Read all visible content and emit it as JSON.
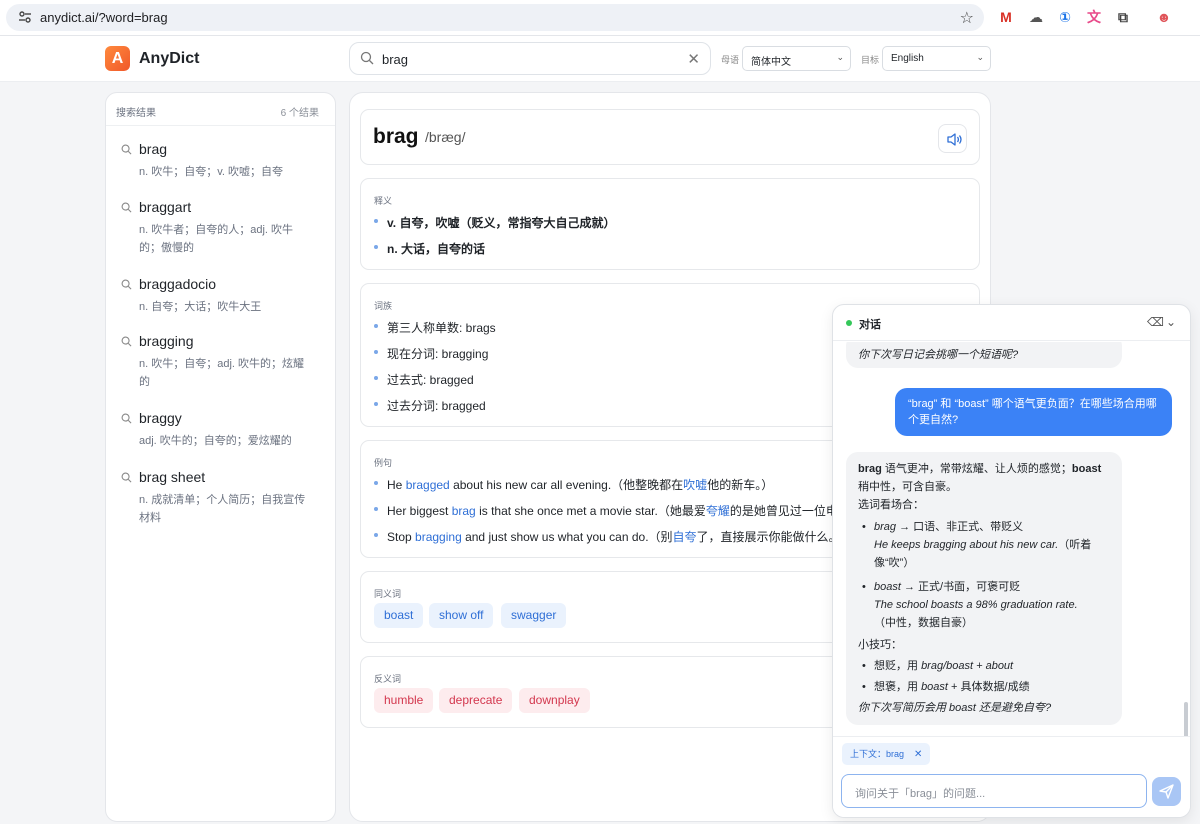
{
  "browser": {
    "url": "anydict.ai/?word=brag",
    "extensions": [
      {
        "name": "gmail-icon",
        "glyph": "M",
        "color": "#d93025"
      },
      {
        "name": "cloud-icon",
        "glyph": "☁",
        "color": "#555555"
      },
      {
        "name": "password-icon",
        "glyph": "①",
        "color": "#1a73e8"
      },
      {
        "name": "translate-icon",
        "glyph": "文",
        "color": "#e84a8a"
      },
      {
        "name": "puzzle-icon",
        "glyph": "⧉",
        "color": "#444444"
      },
      {
        "name": "profile-icon",
        "glyph": "☻",
        "color": "#e0555a"
      }
    ]
  },
  "header": {
    "logo_letter": "A",
    "brand": "AnyDict",
    "search_value": "brag",
    "native_label": "母语",
    "native_value": "简体中文",
    "target_label": "目标",
    "target_value": "English"
  },
  "results": {
    "title": "搜索结果",
    "count": "6 个结果",
    "items": [
      {
        "word": "brag",
        "gloss": "n. 吹牛；自夸；v. 吹嘘；自夸"
      },
      {
        "word": "braggart",
        "gloss": "n. 吹牛者；自夸的人；adj. 吹牛的；傲慢的"
      },
      {
        "word": "braggadocio",
        "gloss": "n. 自夸；大话；吹牛大王"
      },
      {
        "word": "bragging",
        "gloss": "n. 吹牛；自夸；adj. 吹牛的；炫耀的"
      },
      {
        "word": "braggy",
        "gloss": "adj. 吹牛的；自夸的；爱炫耀的"
      },
      {
        "word": "brag sheet",
        "gloss": "n. 成就清单；个人简历；自我宣传材料"
      }
    ]
  },
  "entry": {
    "headword": "brag",
    "phonetic": "/bræg/",
    "definitions_title": "释义",
    "definitions": [
      "v. 自夸，吹嘘（贬义，常指夸大自己成就）",
      "n. 大话，自夸的话"
    ],
    "forms_title": "词族",
    "forms": [
      "第三人称单数: brags",
      "现在分词: bragging",
      "过去式: bragged",
      "过去分词: bragged"
    ],
    "examples_title": "例句",
    "examples": [
      {
        "a": "He ",
        "hl1": "bragged",
        "b": " about his new car all evening.（他整晚都在",
        "hl2": "吹嘘",
        "c": "他的新车。）"
      },
      {
        "a": "Her biggest ",
        "hl1": "brag",
        "b": " is that she once met a movie star.（她最爱",
        "hl2": "夸耀",
        "c": "的是她曾见过一位电影明星。）"
      },
      {
        "a": "Stop ",
        "hl1": "bragging",
        "b": " and just show us what you can do.（别",
        "hl2": "自夸",
        "c": "了，直接展示你能做什么。）"
      }
    ],
    "synonyms_title": "同义词",
    "synonyms": [
      "boast",
      "show off",
      "swagger"
    ],
    "antonyms_title": "反义词",
    "antonyms": [
      "humble",
      "deprecate",
      "downplay"
    ]
  },
  "chat": {
    "title": "对话",
    "prev_ai_tail": "你下次写日记会挑哪一个短语呢?",
    "user_msg": "“brag” 和 “boast” 哪个语气更负面？在哪些场合用哪个更自然?",
    "ai": {
      "l1_b1": "brag",
      "l1_t1": " 语气更冲，常带炫耀、让人烦的感觉；",
      "l1_b2": "boast",
      "l1_t2": " 稍中性，可含自豪。",
      "l2": "选词看场合：",
      "li1_word": "brag",
      "li1_rest": " → 口语、非正式、带贬义",
      "li1_ex": "He keeps bragging about his new car.",
      "li1_tr": "（听着像“吹”）",
      "li2_word": "boast",
      "li2_rest": " → 正式/书面，可褒可贬",
      "li2_ex": "The school boasts a 98% graduation rate.",
      "li2_tr": "（中性，数据自豪）",
      "tips": "小技巧：",
      "tip1_a": "想贬，用 ",
      "tip1_i": "brag/boast + about",
      "tip2_a": "想褒，用 ",
      "tip2_i": "boast",
      "tip2_b": " + 具体数据/成绩",
      "closing": "你下次写简历会用 boast 还是避免自夸?"
    },
    "context_chip": "上下文：brag",
    "input_placeholder": "询问关于「brag」的问题..."
  }
}
